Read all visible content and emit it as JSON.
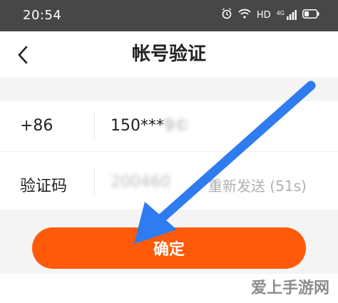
{
  "status_bar": {
    "time": "20:54",
    "hd": "HD",
    "net": "4G",
    "icons": [
      "alarm-icon",
      "wifi-icon",
      "signal-icon",
      "battery-icon"
    ]
  },
  "nav": {
    "back_icon": "chevron-left-icon",
    "title": "帐号验证"
  },
  "form": {
    "country_code": "+86",
    "phone_masked": "150***",
    "phone_blurred": "9©",
    "code_label": "验证码",
    "code_value": "200460",
    "resend_label": "重新发送 (51s)"
  },
  "confirm_button": "确定",
  "watermark": "爱上手游网",
  "annotation": {
    "arrow_color": "#2f7bf0"
  }
}
